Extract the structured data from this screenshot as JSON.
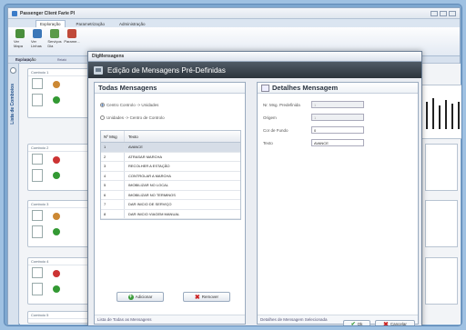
{
  "app": {
    "title": "Passenger Client Farie PI",
    "ribbon_tabs": [
      "Exploração",
      "Parametrização",
      "Administração"
    ],
    "ribbon_buttons": [
      {
        "label": "Ver Mapa",
        "icon": "map-icon"
      },
      {
        "label": "Ver Linhas",
        "icon": "lines-icon"
      },
      {
        "label": "Serviços Dia",
        "icon": "services-icon"
      },
      {
        "label": "Parame...",
        "icon": "params-icon"
      }
    ],
    "ribbon_groups": [
      "Exploração",
      "Relató"
    ],
    "subtab": "Exploração",
    "sidebar_label": "Lista de Comboios",
    "cards": [
      "Comboio 1",
      "Comboio 2",
      "Comboio 3",
      "Comboio 4",
      "Comboio 5"
    ]
  },
  "dialog": {
    "window_title": "DlgMensagens",
    "header_title": "Edição de Mensagens Pré-Definidas",
    "left": {
      "title": "Todas Mensagens",
      "radio_options": [
        "Centro Controlo -> Unidades",
        "Unidades -> Centro de Controlo"
      ],
      "selected_radio": 0,
      "columns": [
        "Nº Msg",
        "Texto"
      ],
      "rows": [
        {
          "n": "1",
          "text": "AVANCE"
        },
        {
          "n": "2",
          "text": "ATRASAR MARCHA"
        },
        {
          "n": "3",
          "text": "RECOLHER A ESTAÇÃO"
        },
        {
          "n": "4",
          "text": "CONTROLAR A MARCHA"
        },
        {
          "n": "5",
          "text": "IMOBILIZAR NO LOCAL"
        },
        {
          "n": "6",
          "text": "IMOBILIZAR NO TERMINOS"
        },
        {
          "n": "7",
          "text": "DAR INICIO DE SERVIÇO"
        },
        {
          "n": "8",
          "text": "DAR INICIO VIAGEM MANUAL"
        }
      ],
      "add_label": "Adicionar",
      "remove_label": "Remover",
      "footer": "Lista de Todas as Mensagens"
    },
    "right": {
      "title": "Detalhes Mensagem",
      "fields": [
        {
          "label": "Nr. Msg. Predefinida",
          "value": "1",
          "disabled": true
        },
        {
          "label": "Origem",
          "value": "1",
          "disabled": true
        },
        {
          "label": "Cor de Fundo",
          "value": "0",
          "disabled": false
        },
        {
          "label": "Texto",
          "value": "AVANCE",
          "disabled": false
        }
      ],
      "footer": "Detalhes de Mensagem Selecionada"
    },
    "ok_label": "Ok",
    "cancel_label": "Cancelar"
  }
}
